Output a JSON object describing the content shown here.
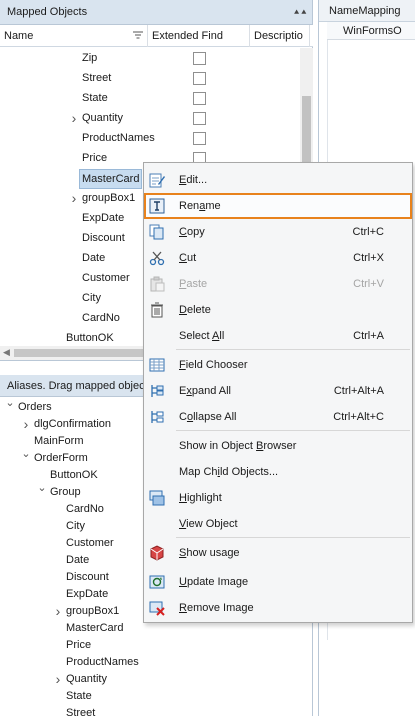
{
  "mapped_panel": {
    "title": "Mapped Objects",
    "columns": [
      "Name",
      "Extended Find",
      "Descriptio"
    ],
    "rows": [
      {
        "label": "Zip",
        "indent": 82,
        "expander": false,
        "checkbox": true
      },
      {
        "label": "Street",
        "indent": 82,
        "expander": false,
        "checkbox": true
      },
      {
        "label": "State",
        "indent": 82,
        "expander": false,
        "checkbox": true
      },
      {
        "label": "Quantity",
        "indent": 82,
        "expander": true,
        "checkbox": true
      },
      {
        "label": "ProductNames",
        "indent": 82,
        "expander": false,
        "checkbox": true
      },
      {
        "label": "Price",
        "indent": 82,
        "expander": false,
        "checkbox": true
      },
      {
        "label": "MasterCard",
        "indent": 82,
        "expander": false,
        "checkbox": false,
        "selected": true
      },
      {
        "label": "groupBox1",
        "indent": 82,
        "expander": true,
        "checkbox": false
      },
      {
        "label": "ExpDate",
        "indent": 82,
        "expander": false,
        "checkbox": false
      },
      {
        "label": "Discount",
        "indent": 82,
        "expander": false,
        "checkbox": false
      },
      {
        "label": "Date",
        "indent": 82,
        "expander": false,
        "checkbox": false
      },
      {
        "label": "Customer",
        "indent": 82,
        "expander": false,
        "checkbox": false
      },
      {
        "label": "City",
        "indent": 82,
        "expander": false,
        "checkbox": false
      },
      {
        "label": "CardNo",
        "indent": 82,
        "expander": false,
        "checkbox": false
      },
      {
        "label": "ButtonOK",
        "indent": 66,
        "expander": false,
        "checkbox": false
      }
    ]
  },
  "aliases_panel": {
    "title": "Aliases. Drag mapped object",
    "rows": [
      {
        "label": "Orders",
        "level": 0,
        "expander": "open"
      },
      {
        "label": "dlgConfirmation",
        "level": 1,
        "expander": "closed"
      },
      {
        "label": "MainForm",
        "level": 1,
        "expander": "none"
      },
      {
        "label": "OrderForm",
        "level": 1,
        "expander": "open"
      },
      {
        "label": "ButtonOK",
        "level": 2,
        "expander": "none"
      },
      {
        "label": "Group",
        "level": 2,
        "expander": "open"
      },
      {
        "label": "CardNo",
        "level": 3,
        "expander": "none"
      },
      {
        "label": "City",
        "level": 3,
        "expander": "none"
      },
      {
        "label": "Customer",
        "level": 3,
        "expander": "none"
      },
      {
        "label": "Date",
        "level": 3,
        "expander": "none"
      },
      {
        "label": "Discount",
        "level": 3,
        "expander": "none"
      },
      {
        "label": "ExpDate",
        "level": 3,
        "expander": "none"
      },
      {
        "label": "groupBox1",
        "level": 3,
        "expander": "closed"
      },
      {
        "label": "MasterCard",
        "level": 3,
        "expander": "none"
      },
      {
        "label": "Price",
        "level": 3,
        "expander": "none"
      },
      {
        "label": "ProductNames",
        "level": 3,
        "expander": "none"
      },
      {
        "label": "Quantity",
        "level": 3,
        "expander": "closed"
      },
      {
        "label": "State",
        "level": 3,
        "expander": "none"
      },
      {
        "label": "Street",
        "level": 3,
        "expander": "none"
      }
    ]
  },
  "right_panel": {
    "tab": "NameMapping",
    "sub": "WinFormsO"
  },
  "context_menu": {
    "items": [
      {
        "pre": "",
        "u": "E",
        "post": "dit...",
        "shortcut": "",
        "icon": "edit-icon"
      },
      {
        "pre": "Ren",
        "u": "a",
        "post": "me",
        "shortcut": "",
        "icon": "rename-icon",
        "highlighted": true
      },
      {
        "pre": "",
        "u": "C",
        "post": "opy",
        "shortcut": "Ctrl+C",
        "icon": "copy-icon"
      },
      {
        "pre": "",
        "u": "C",
        "post": "ut",
        "shortcut": "Ctrl+X",
        "icon": "cut-icon"
      },
      {
        "pre": "",
        "u": "P",
        "post": "aste",
        "shortcut": "Ctrl+V",
        "icon": "paste-icon",
        "disabled": true
      },
      {
        "pre": "",
        "u": "D",
        "post": "elete",
        "shortcut": "",
        "icon": "delete-icon"
      },
      {
        "pre": "Select ",
        "u": "A",
        "post": "ll",
        "shortcut": "Ctrl+A",
        "icon": "none"
      },
      {
        "pre": "",
        "u": "F",
        "post": "ield Chooser",
        "shortcut": "",
        "icon": "field-chooser-icon"
      },
      {
        "pre": "E",
        "u": "x",
        "post": "pand All",
        "shortcut": "Ctrl+Alt+A",
        "icon": "expand-all-icon"
      },
      {
        "pre": "C",
        "u": "o",
        "post": "llapse All",
        "shortcut": "Ctrl+Alt+C",
        "icon": "collapse-all-icon"
      },
      {
        "pre": "Show in Object ",
        "u": "B",
        "post": "rowser",
        "shortcut": "",
        "icon": "none"
      },
      {
        "pre": "Map Ch",
        "u": "i",
        "post": "ld Objects...",
        "shortcut": "",
        "icon": "none"
      },
      {
        "pre": "",
        "u": "H",
        "post": "ighlight",
        "shortcut": "",
        "icon": "highlight-icon"
      },
      {
        "pre": "",
        "u": "V",
        "post": "iew Object",
        "shortcut": "",
        "icon": "none"
      },
      {
        "pre": "",
        "u": "S",
        "post": "how usage",
        "shortcut": "",
        "icon": "show-usage-icon"
      },
      {
        "pre": "",
        "u": "U",
        "post": "pdate Image",
        "shortcut": "",
        "icon": "update-image-icon"
      },
      {
        "pre": "",
        "u": "R",
        "post": "emove Image",
        "shortcut": "",
        "icon": "remove-image-icon"
      }
    ]
  }
}
